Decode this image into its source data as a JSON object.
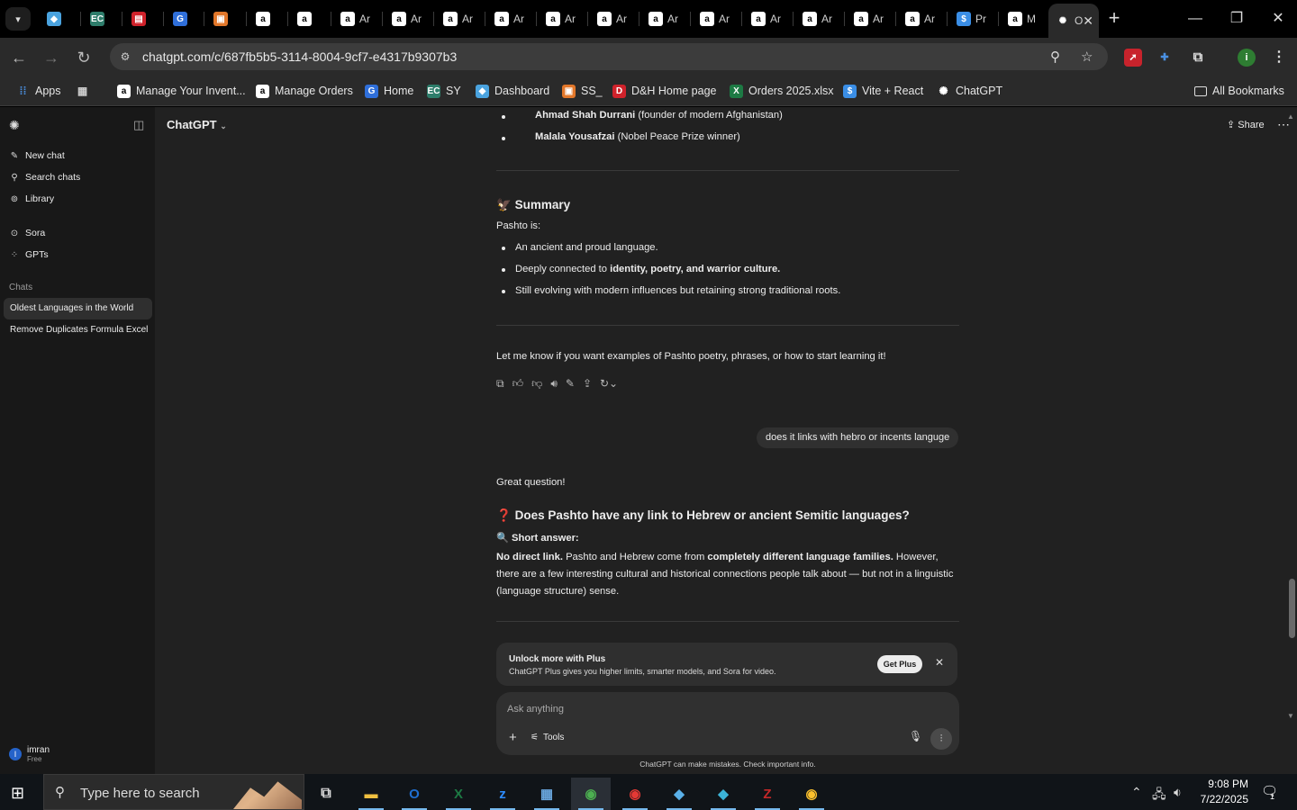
{
  "browser": {
    "tabs_menu_icon": "chevron-down-icon",
    "tabs": [
      {
        "label": "",
        "icon": "chevron-hex-icon",
        "color": "#4aa3df"
      },
      {
        "label": "",
        "icon": "ec-icon",
        "color": "#2e7d6b"
      },
      {
        "label": "",
        "icon": "pdf-icon",
        "color": "#d0222b"
      },
      {
        "label": "",
        "icon": "docs-icon",
        "color": "#2f6fda"
      },
      {
        "label": "",
        "icon": "seller-icon",
        "color": "#e2772a"
      },
      {
        "label": "",
        "icon": "amazon-icon",
        "color": "#ffffff"
      },
      {
        "label": "",
        "icon": "amazon-icon",
        "color": "#ffffff"
      },
      {
        "label": "Ar",
        "icon": "amazon-icon",
        "color": "#ffffff"
      },
      {
        "label": "Ar",
        "icon": "amazon-icon",
        "color": "#ffffff"
      },
      {
        "label": "Ar",
        "icon": "amazon-icon",
        "color": "#ffffff"
      },
      {
        "label": "Ar",
        "icon": "amazon-icon",
        "color": "#ffffff"
      },
      {
        "label": "Ar",
        "icon": "amazon-icon",
        "color": "#ffffff"
      },
      {
        "label": "Ar",
        "icon": "amazon-icon",
        "color": "#ffffff"
      },
      {
        "label": "Ar",
        "icon": "amazon-icon",
        "color": "#ffffff"
      },
      {
        "label": "Ar",
        "icon": "amazon-icon",
        "color": "#ffffff"
      },
      {
        "label": "Ar",
        "icon": "amazon-icon",
        "color": "#ffffff"
      },
      {
        "label": "Ar",
        "icon": "amazon-icon",
        "color": "#ffffff"
      },
      {
        "label": "Ar",
        "icon": "amazon-icon",
        "color": "#ffffff"
      },
      {
        "label": "Ar",
        "icon": "amazon-icon",
        "color": "#ffffff"
      },
      {
        "label": "Pr",
        "icon": "dollar-icon",
        "color": "#3a8ee6"
      },
      {
        "label": "M",
        "icon": "amazon-icon",
        "color": "#ffffff"
      },
      {
        "label": "O",
        "icon": "openai-icon",
        "color": "#ffffff"
      }
    ],
    "new_tab_icon": "plus-icon",
    "window": {
      "minimize": "—",
      "restore": "❐",
      "close": "✕"
    },
    "url": "chatgpt.com/c/687fb5b5-3114-8004-9cf7-e4317b9307b3",
    "bookmarks": [
      {
        "label": "Apps",
        "icon": "apps-grid-icon"
      },
      {
        "label": "",
        "icon": "tab-groups-icon"
      },
      {
        "label": "Manage Your Invent...",
        "icon": "amazon-icon"
      },
      {
        "label": "Manage Orders",
        "icon": "amazon-icon"
      },
      {
        "label": "Home",
        "icon": "home-site-icon"
      },
      {
        "label": "SY",
        "icon": "ec-icon"
      },
      {
        "label": "Dashboard",
        "icon": "chevron-hex-icon"
      },
      {
        "label": "SS_",
        "icon": "seller-icon"
      },
      {
        "label": "D&H Home page",
        "icon": "dh-icon"
      },
      {
        "label": "Orders 2025.xlsx",
        "icon": "excel-icon"
      },
      {
        "label": "Vite + React",
        "icon": "dollar-icon"
      },
      {
        "label": "ChatGPT",
        "icon": "openai-icon"
      }
    ],
    "all_bookmarks": "All Bookmarks"
  },
  "sidebar": {
    "nav": [
      {
        "label": "New chat",
        "icon": "edit-icon"
      },
      {
        "label": "Search chats",
        "icon": "search-icon"
      },
      {
        "label": "Library",
        "icon": "library-icon"
      },
      {
        "label": "Sora",
        "icon": "sora-icon"
      },
      {
        "label": "GPTs",
        "icon": "grid-icon"
      }
    ],
    "chats_heading": "Chats",
    "chats": [
      "Oldest Languages in the World",
      "Remove Duplicates Formula Excel"
    ],
    "user": {
      "initial": "I",
      "name": "imran",
      "plan": "Free"
    }
  },
  "header": {
    "model": "ChatGPT",
    "share": "Share"
  },
  "conversation": {
    "top_bullets": [
      {
        "bold": "Ahmad Shah Durrani",
        "rest": " (founder of modern Afghanistan)"
      },
      {
        "bold": "Malala Yousafzai",
        "rest": " (Nobel Peace Prize winner)"
      }
    ],
    "summary_emoji": "🦅",
    "summary_title": "Summary",
    "summary_intro": "Pashto is:",
    "summary_bullets": [
      {
        "pre": "An ancient and proud language.",
        "bold": "",
        "post": ""
      },
      {
        "pre": "Deeply connected to ",
        "bold": "identity, poetry, and warrior culture.",
        "post": ""
      },
      {
        "pre": "Still evolving with modern influences but retaining strong traditional roots.",
        "bold": "",
        "post": ""
      }
    ],
    "closing": "Let me know if you want examples of Pashto poetry, phrases, or how to start learning it!",
    "user_message": "does it links with hebro or incents languge",
    "reply_opening": "Great question!",
    "reply_heading_emoji": "❓",
    "reply_heading": "Does Pashto have any link to Hebrew or ancient Semitic languages?",
    "short_answer_emoji": "🔍",
    "short_answer_label": "Short answer:",
    "answer_bold": "No direct link.",
    "answer_text_1": " Pashto and Hebrew come from ",
    "answer_bold_2": "completely different language families.",
    "answer_text_2": " However, there are a few interesting cultural and historical connections people talk about — but not in a linguistic (language structure) sense."
  },
  "promo": {
    "title": "Unlock more with Plus",
    "subtitle": "ChatGPT Plus gives you higher limits, smarter models, and Sora for video.",
    "button": "Get Plus"
  },
  "composer": {
    "placeholder": "Ask anything",
    "tools": "Tools"
  },
  "disclaimer": "ChatGPT can make mistakes. Check important info.",
  "taskbar": {
    "search_placeholder": "Type here to search",
    "apps": [
      {
        "name": "file-explorer-icon",
        "glyph": "▬",
        "color": "#f0c040"
      },
      {
        "name": "outlook-icon",
        "glyph": "O",
        "color": "#1f6fd1"
      },
      {
        "name": "excel-icon",
        "glyph": "X",
        "color": "#1d7a44"
      },
      {
        "name": "zoom-icon",
        "glyph": "z",
        "color": "#2d8cff"
      },
      {
        "name": "calculator-icon",
        "glyph": "▦",
        "color": "#6aa8e0"
      },
      {
        "name": "chrome-icon",
        "glyph": "◉",
        "color": "#4caf50"
      },
      {
        "name": "chrome-icon",
        "glyph": "◉",
        "color": "#e53935"
      },
      {
        "name": "app-icon",
        "glyph": "◆",
        "color": "#5ab0e8"
      },
      {
        "name": "app-icon",
        "glyph": "◆",
        "color": "#3cb4d8"
      },
      {
        "name": "filezilla-icon",
        "glyph": "Z",
        "color": "#c62828"
      },
      {
        "name": "chrome-icon",
        "glyph": "◉",
        "color": "#fbc02d"
      }
    ],
    "time": "9:08 PM",
    "date": "7/22/2025",
    "notification_count": "1"
  }
}
